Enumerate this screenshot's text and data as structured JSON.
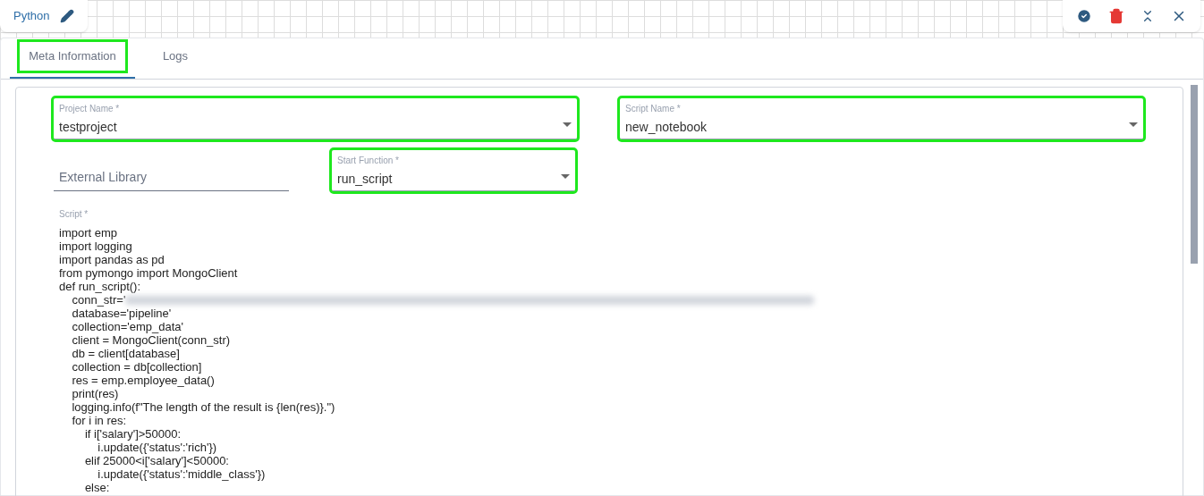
{
  "header": {
    "title": "Python"
  },
  "tabs": [
    {
      "label": "Meta Information",
      "selected": true,
      "highlighted": true
    },
    {
      "label": "Logs",
      "selected": false,
      "highlighted": false
    }
  ],
  "fields": {
    "project_name": {
      "label": "Project Name *",
      "value": "testproject",
      "highlighted": true
    },
    "script_name": {
      "label": "Script Name *",
      "value": "new_notebook",
      "highlighted": true
    },
    "external_library": {
      "placeholder": "External Library"
    },
    "start_function": {
      "label": "Start Function *",
      "value": "run_script",
      "highlighted": true
    }
  },
  "script": {
    "label": "Script *",
    "lines": [
      {
        "text": "import emp",
        "redacted": false
      },
      {
        "text": "import logging",
        "redacted": false
      },
      {
        "text": "import pandas as pd",
        "redacted": false
      },
      {
        "text": "from pymongo import MongoClient",
        "redacted": false
      },
      {
        "text": "def run_script():",
        "redacted": false
      },
      {
        "text": "    conn_str='",
        "redacted": true
      },
      {
        "text": "    database='pipeline'",
        "redacted": false
      },
      {
        "text": "    collection='emp_data'",
        "redacted": false
      },
      {
        "text": "    client = MongoClient(conn_str)",
        "redacted": false
      },
      {
        "text": "    db = client[database]",
        "redacted": false
      },
      {
        "text": "    collection = db[collection]",
        "redacted": false
      },
      {
        "text": "    res = emp.employee_data()",
        "redacted": false
      },
      {
        "text": "    print(res)",
        "redacted": false
      },
      {
        "text": "    logging.info(f\"The length of the result is {len(res)}.\")",
        "redacted": false
      },
      {
        "text": "    for i in res:",
        "redacted": false
      },
      {
        "text": "        if i['salary']>50000:",
        "redacted": false
      },
      {
        "text": "            i.update({'status':'rich'})",
        "redacted": false
      },
      {
        "text": "        elif 25000<i['salary']<50000:",
        "redacted": false
      },
      {
        "text": "            i.update({'status':'middle_class'})",
        "redacted": false
      },
      {
        "text": "        else:",
        "redacted": false
      }
    ]
  }
}
